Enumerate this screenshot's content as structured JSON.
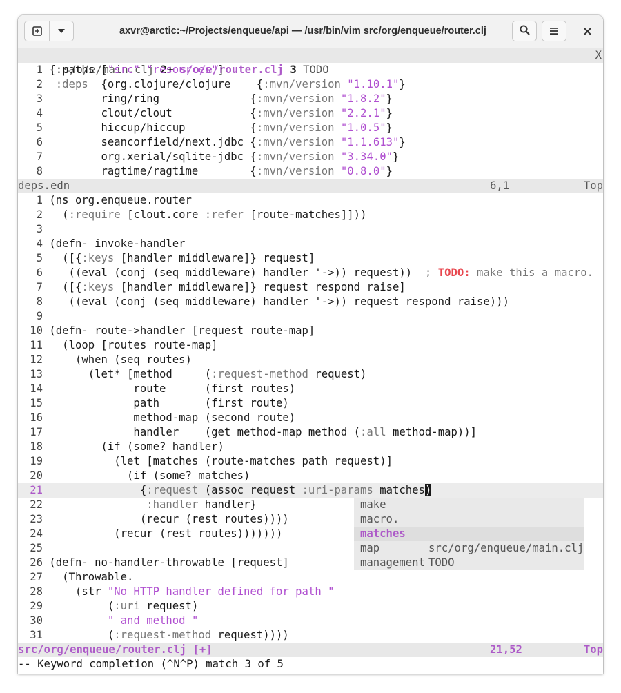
{
  "window": {
    "title": "axvr@arctic:~/Projects/enqueue/api — /usr/bin/vim src/org/enqueue/router.clj"
  },
  "titlebar": {
    "new_tab_icon": "new-tab-icon",
    "menu_dropdown_icon": "chevron-down-icon",
    "search_icon": "search-icon",
    "hamburger_icon": "hamburger-menu-icon",
    "close_icon": "close-icon"
  },
  "tabs": {
    "tab1": "s/o/e/main.clj",
    "tab2_num": "2+",
    "tab2": "s/o/e/router.clj",
    "tab3_num": "3",
    "tab3": "TODO",
    "close": "X"
  },
  "top_pane": {
    "lines": [
      {
        "n": "1",
        "text": "{:paths [\"src\" \"resources\"]"
      },
      {
        "n": "2",
        "text": " :deps  {org.clojure/clojure    {:mvn/version \"1.10.1\"}"
      },
      {
        "n": "3",
        "text": "        ring/ring              {:mvn/version \"1.8.2\"}"
      },
      {
        "n": "4",
        "text": "        clout/clout            {:mvn/version \"2.2.1\"}"
      },
      {
        "n": "5",
        "text": "        hiccup/hiccup          {:mvn/version \"1.0.5\"}"
      },
      {
        "n": "6",
        "text": "        seancorfield/next.jdbc {:mvn/version \"1.1.613\"}"
      },
      {
        "n": "7",
        "text": "        org.xerial/sqlite-jdbc {:mvn/version \"3.34.0\"}"
      },
      {
        "n": "8",
        "text": "        ragtime/ragtime        {:mvn/version \"0.8.0\"}"
      }
    ],
    "status_file": "deps.edn",
    "status_pos": "6,1",
    "status_scroll": "Top"
  },
  "bottom_pane": {
    "lines": [
      {
        "n": "1",
        "text": "(ns org.enqueue.router"
      },
      {
        "n": "2",
        "text": "  (:require [clout.core :refer [route-matches]]))"
      },
      {
        "n": "3",
        "text": ""
      },
      {
        "n": "4",
        "text": "(defn- invoke-handler"
      },
      {
        "n": "5",
        "text": "  ([{:keys [handler middleware]} request]"
      },
      {
        "n": "6",
        "text": "   ((eval (conj (seq middleware) handler '->)) request))  ; TODO: make this a macro."
      },
      {
        "n": "7",
        "text": "  ([{:keys [handler middleware]} request respond raise]"
      },
      {
        "n": "8",
        "text": "   ((eval (conj (seq middleware) handler '->)) request respond raise)))"
      },
      {
        "n": "9",
        "text": ""
      },
      {
        "n": "10",
        "text": "(defn- route->handler [request route-map]"
      },
      {
        "n": "11",
        "text": "  (loop [routes route-map]"
      },
      {
        "n": "12",
        "text": "    (when (seq routes)"
      },
      {
        "n": "13",
        "text": "      (let* [method     (:request-method request)"
      },
      {
        "n": "14",
        "text": "             route      (first routes)"
      },
      {
        "n": "15",
        "text": "             path       (first route)"
      },
      {
        "n": "16",
        "text": "             method-map (second route)"
      },
      {
        "n": "17",
        "text": "             handler    (get method-map method (:all method-map))]"
      },
      {
        "n": "18",
        "text": "        (if (some? handler)"
      },
      {
        "n": "19",
        "text": "          (let [matches (route-matches path request)]"
      },
      {
        "n": "20",
        "text": "            (if (some? matches)"
      },
      {
        "n": "21",
        "text": "              {:request (assoc request :uri-params matches)"
      },
      {
        "n": "22",
        "text": "               :handler handler}"
      },
      {
        "n": "23",
        "text": "              (recur (rest routes))))"
      },
      {
        "n": "24",
        "text": "          (recur (rest routes)))))))"
      },
      {
        "n": "25",
        "text": ""
      },
      {
        "n": "26",
        "text": "(defn- no-handler-throwable [request]"
      },
      {
        "n": "27",
        "text": "  (Throwable."
      },
      {
        "n": "28",
        "text": "    (str \"No HTTP handler defined for path \""
      },
      {
        "n": "29",
        "text": "         (:uri request)"
      },
      {
        "n": "30",
        "text": "         \" and method \""
      },
      {
        "n": "31",
        "text": "         (:request-method request))))"
      }
    ],
    "status_file": "src/org/enqueue/router.clj [+]",
    "status_pos": "21,52",
    "status_scroll": "Top"
  },
  "completion": {
    "items": [
      {
        "word": "make",
        "menu": ""
      },
      {
        "word": "macro.",
        "menu": ""
      },
      {
        "word": "matches",
        "menu": ""
      },
      {
        "word": "map",
        "menu": "src/org/enqueue/main.clj"
      },
      {
        "word": "management",
        "menu": "TODO"
      }
    ],
    "selected_index": 2
  },
  "message": "-- Keyword completion (^N^P) match 3 of 5",
  "colors": {
    "accent": "#ad5ac8",
    "string": "#b050d0",
    "todo": "#e8474f",
    "statusbar": "#e8e8e8"
  }
}
